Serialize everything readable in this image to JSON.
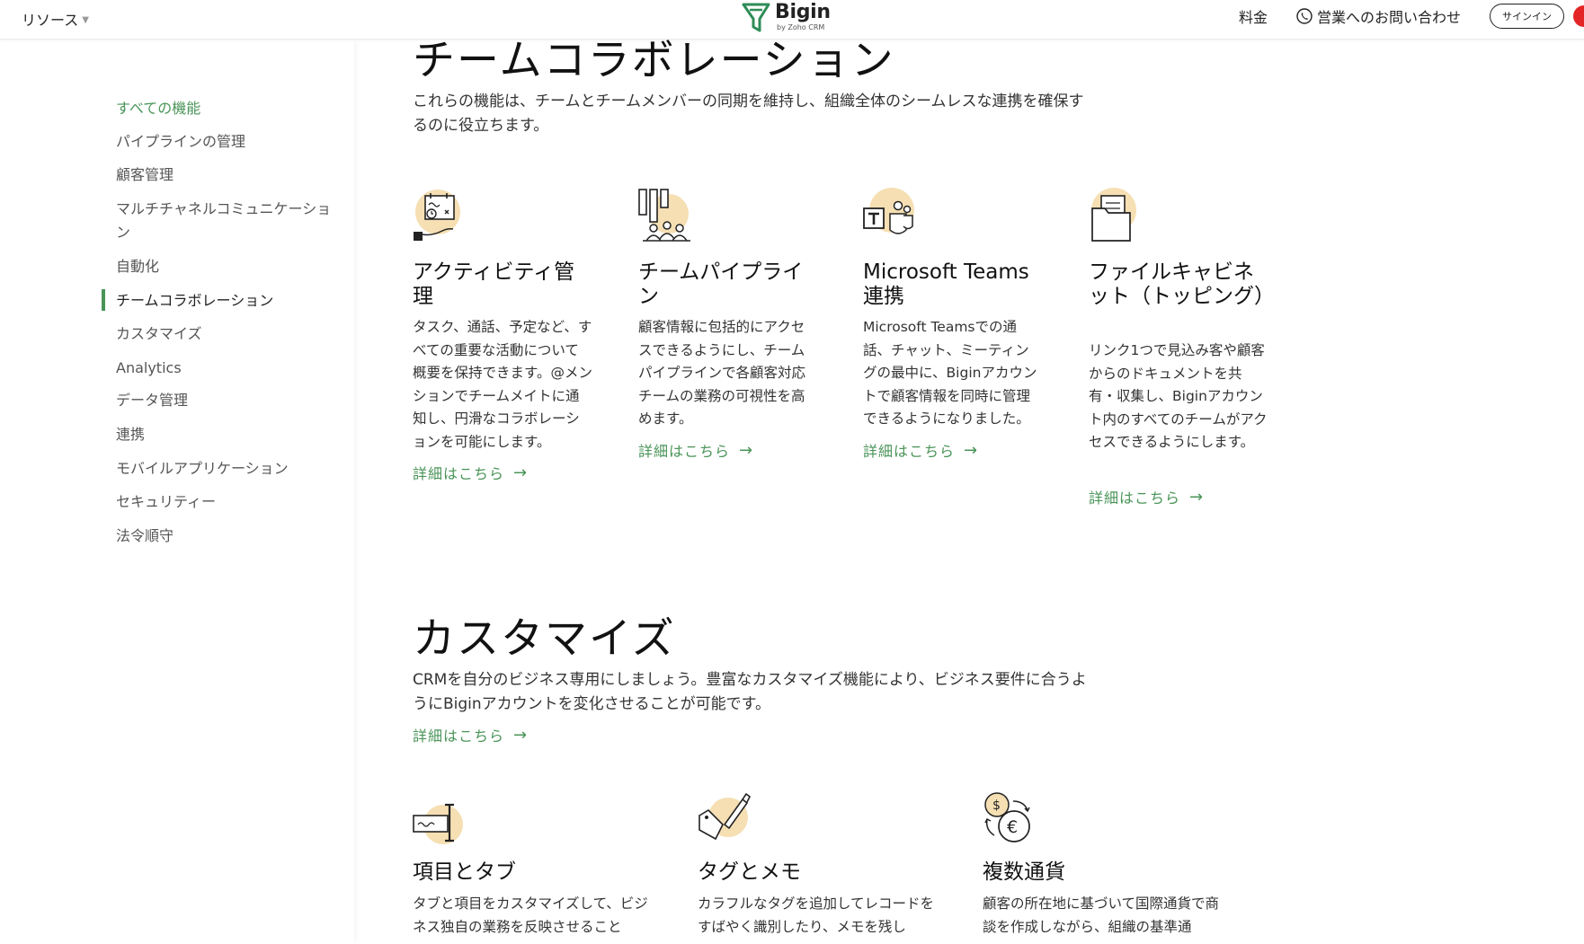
{
  "header": {
    "resources_label": "リソース",
    "logo_name": "Bigin",
    "logo_sub": "by Zoho CRM",
    "pricing_label": "料金",
    "contact_label": "営業へのお問い合わせ",
    "signin_label": "サインイン"
  },
  "sidebar": {
    "items": [
      "すべての機能",
      "パイプラインの管理",
      "顧客管理",
      "マルチチャネルコミュニケーション",
      "自動化",
      "チームコラボレーション",
      "カスタマイズ",
      "Analytics",
      "データ管理",
      "連携",
      "モバイルアプリケーション",
      "セキュリティー",
      "法令順守"
    ],
    "active_index": 0,
    "current_index": 5
  },
  "team_section": {
    "title": "チームコラボレーション",
    "description": "これらの機能は、チームとチームメンバーの同期を維持し、組織全体のシームレスな連携を確保するのに役立ちます。",
    "cards": [
      {
        "icon": "activity-calendar-icon",
        "title": "アクティビティ管理",
        "text": "タスク、通話、予定など、すべての重要な活動について概要を保持できます。@メンションでチームメイトに通知し、円滑なコラボレーションを可能にします。",
        "link": "詳細はこちら"
      },
      {
        "icon": "team-pipeline-icon",
        "title": "チームパイプライン",
        "text": "顧客情報に包括的にアクセスできるようにし、チームパイプラインで各顧客対応チームの業務の可視性を高めます。",
        "link": "詳細はこちら"
      },
      {
        "icon": "microsoft-teams-icon",
        "title": "Microsoft Teams連携",
        "text": "Microsoft Teamsでの通話、チャット、ミーティングの最中に、Biginアカウントで顧客情報を同時に管理できるようになりました。",
        "link": "詳細はこちら"
      },
      {
        "icon": "file-cabinet-icon",
        "title": "ファイルキャビネット（トッピング）",
        "text": "リンク1つで見込み客や顧客からのドキュメントを共有・収集し、Biginアカウント内のすべてのチームがアクセスできるようにします。",
        "link": "詳細はこちら"
      }
    ]
  },
  "customize_section": {
    "title": "カスタマイズ",
    "description": "CRMを自分のビジネス専用にしましょう。豊富なカスタマイズ機能により、ビジネス要件に合うようにBiginアカウントを変化させることが可能です。",
    "link": "詳細はこちら",
    "cards": [
      {
        "icon": "fields-tabs-icon",
        "title": "項目とタブ",
        "text": "タブと項目をカスタマイズして、ビジネス独自の業務を反映させること"
      },
      {
        "icon": "tag-pen-icon",
        "title": "タグとメモ",
        "text": "カラフルなタグを追加してレコードをすばやく識別したり、メモを残し"
      },
      {
        "icon": "currency-exchange-icon",
        "title": "複数通貨",
        "text": "顧客の所在地に基づいて国際通貨で商談を作成しながら、組織の基準通"
      }
    ]
  },
  "colors": {
    "accent_green": "#4a9458",
    "icon_circle": "#f5dfb3",
    "signin_red": "#e42527"
  }
}
